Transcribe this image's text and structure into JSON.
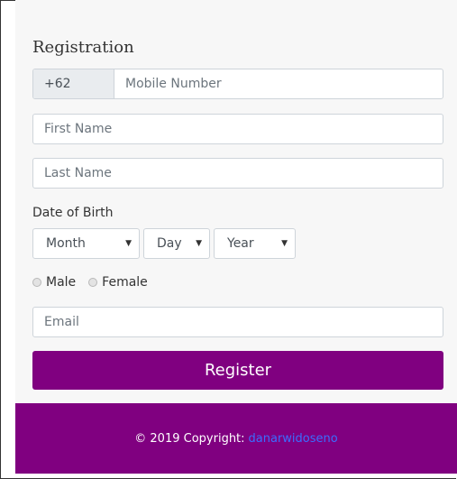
{
  "form": {
    "title": "Registration",
    "phone_prefix": "+62",
    "mobile_placeholder": "Mobile Number",
    "first_name_placeholder": "First Name",
    "last_name_placeholder": "Last Name",
    "dob_label": "Date of Birth",
    "month": "Month",
    "day": "Day",
    "year": "Year",
    "gender_male": "Male",
    "gender_female": "Female",
    "email_placeholder": "Email",
    "register_label": "Register"
  },
  "footer": {
    "copyright": "© 2019 Copyright:",
    "link": "danarwidoseno"
  },
  "colors": {
    "accent": "#800080",
    "link": "#3b6cff"
  }
}
